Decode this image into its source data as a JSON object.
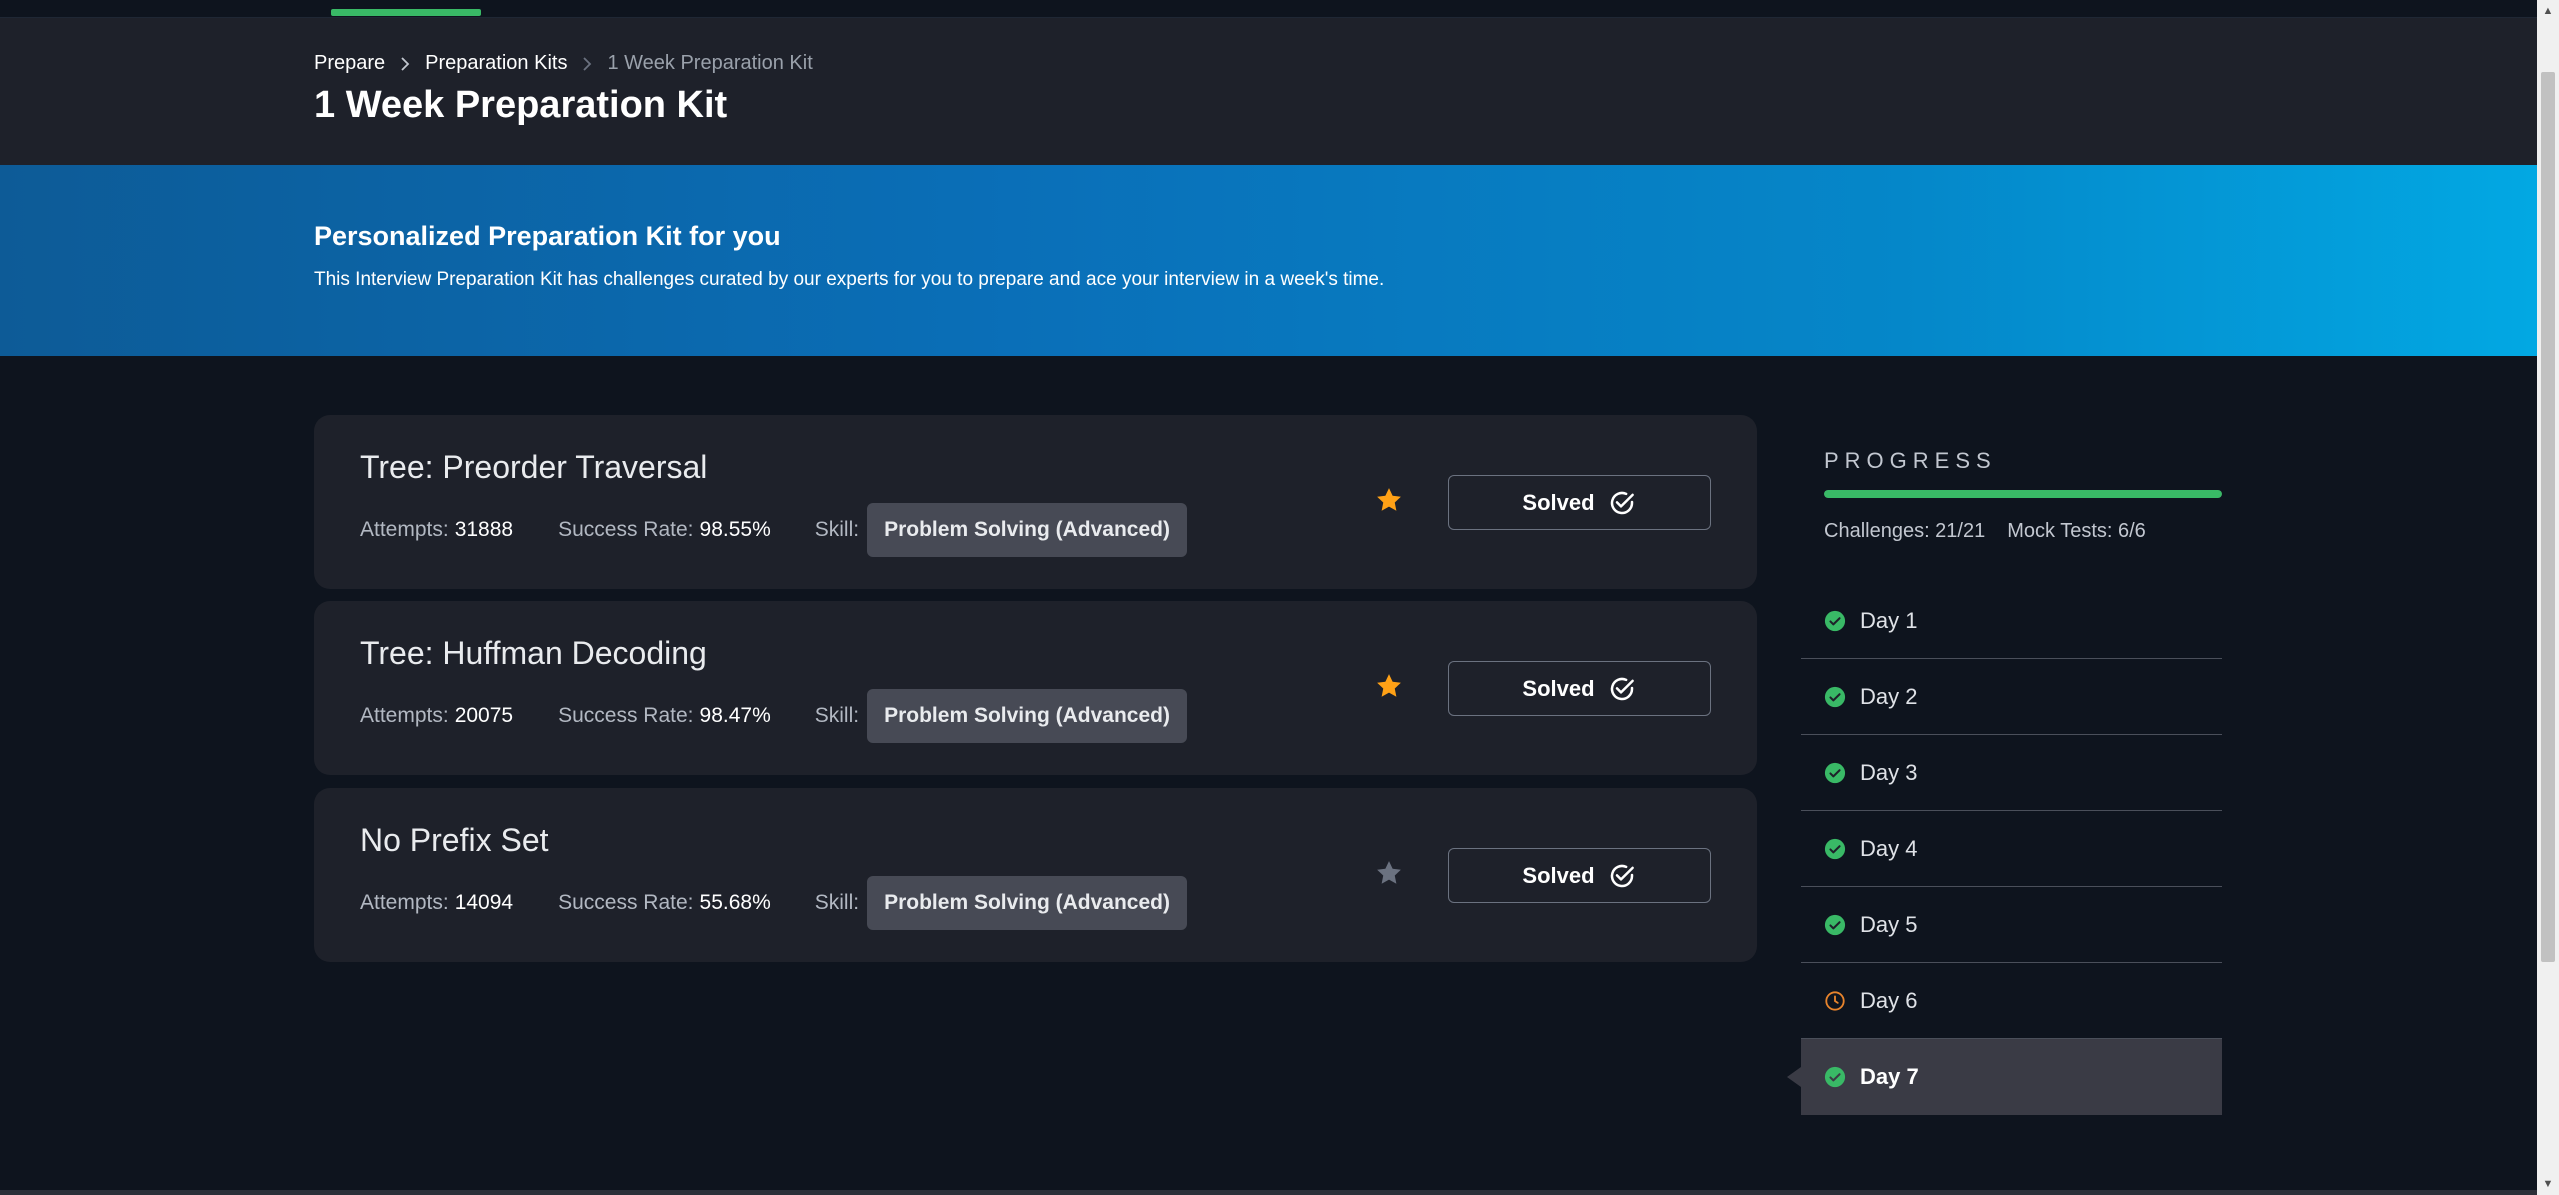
{
  "breadcrumb": {
    "items": [
      {
        "label": "Prepare"
      },
      {
        "label": "Preparation Kits"
      },
      {
        "label": "1 Week Preparation Kit"
      }
    ],
    "separator": ">"
  },
  "page_title": "1 Week Preparation Kit",
  "banner": {
    "heading": "Personalized Preparation Kit for you",
    "description": "This Interview Preparation Kit has challenges curated by our experts for you to prepare and ace your interview in a week's time."
  },
  "labels": {
    "attempts": "Attempts:",
    "success_rate": "Success Rate:",
    "skill": "Skill:"
  },
  "challenges": [
    {
      "title": "Tree: Preorder Traversal",
      "attempts": "31888",
      "success_rate": "98.55%",
      "skill": "Problem Solving (Advanced)",
      "starred": true,
      "status": "Solved"
    },
    {
      "title": "Tree: Huffman Decoding",
      "attempts": "20075",
      "success_rate": "98.47%",
      "skill": "Problem Solving (Advanced)",
      "starred": true,
      "status": "Solved"
    },
    {
      "title": "No Prefix Set",
      "attempts": "14094",
      "success_rate": "55.68%",
      "skill": "Problem Solving (Advanced)",
      "starred": false,
      "status": "Solved"
    }
  ],
  "progress": {
    "title": "PROGRESS",
    "fill_fraction": 1.0,
    "challenges_text": "Challenges: 21/21",
    "mock_tests_text": "Mock Tests: 6/6",
    "days": [
      {
        "label": "Day 1",
        "status": "complete"
      },
      {
        "label": "Day 2",
        "status": "complete"
      },
      {
        "label": "Day 3",
        "status": "complete"
      },
      {
        "label": "Day 4",
        "status": "complete"
      },
      {
        "label": "Day 5",
        "status": "complete"
      },
      {
        "label": "Day 6",
        "status": "in-progress"
      },
      {
        "label": "Day 7",
        "status": "complete",
        "active": true
      }
    ]
  },
  "icons": {
    "breadcrumb_separator": "chevron-right-icon",
    "star": "star-icon",
    "solved": "check-circle-icon",
    "day_complete": "check-circle-filled-icon",
    "day_in_progress": "clock-icon"
  },
  "colors": {
    "accent_green": "#39b966",
    "star_active": "#ffa116",
    "star_inactive": "#6b7280",
    "clock_orange": "#e8842c",
    "card_bg": "#1e212a",
    "page_bg": "#0e141e"
  }
}
